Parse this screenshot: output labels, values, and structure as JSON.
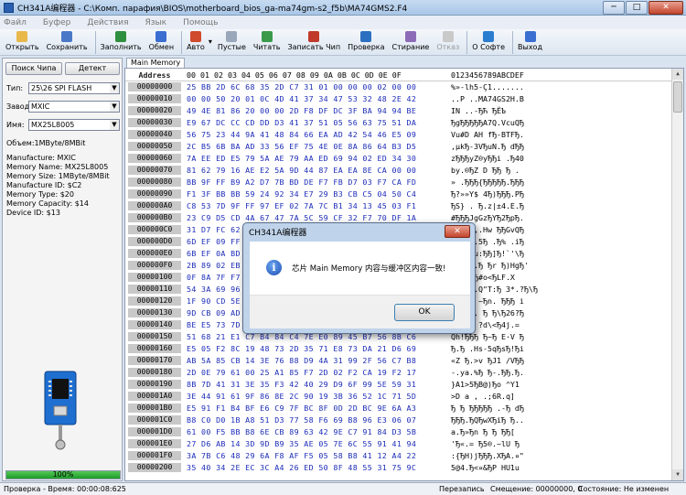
{
  "window": {
    "title": "CH341A编程器 - C:\\Комп. парафия\\BIOS\\motherboard_bios_ga-ma74gm-s2_f5b\\MA74GMS2.F4",
    "min": "─",
    "max": "□",
    "close": "✕"
  },
  "menu": [
    "Файл",
    "Буфер",
    "Действия",
    "Язык",
    "Помощь"
  ],
  "toolbar": [
    {
      "label": "Открыть",
      "color": "#e8b84a"
    },
    {
      "label": "Сохранить",
      "color": "#4a78c8"
    },
    {
      "label": "Заполнить",
      "color": "#2e8f3e"
    },
    {
      "label": "Обмен",
      "color": "#3a6ed0"
    },
    {
      "label": "Авто",
      "color": "#d04a2e"
    },
    {
      "label": "Пустые",
      "color": "#9aa7ba"
    },
    {
      "label": "Читать",
      "color": "#3a9a4a"
    },
    {
      "label": "Записать Чип",
      "color": "#c0392b"
    },
    {
      "label": "Проверка",
      "color": "#2b6fc0"
    },
    {
      "label": "Стирание",
      "color": "#8e6bb8"
    },
    {
      "label": "Отказ",
      "color": "#c9c9c9",
      "disabled": true
    },
    {
      "label": "О Софте",
      "color": "#2b7dd0"
    },
    {
      "label": "Выход",
      "color": "#3a6ed0"
    }
  ],
  "left": {
    "find_chip": "Поиск Чипа",
    "detect": "Детект",
    "type_label": "Тип:",
    "type_value": "25\\26 SPI FLASH",
    "vendor_label": "Завод:",
    "vendor_value": "MXIC",
    "name_label": "Имя:",
    "name_value": "MX25L8005",
    "size_line": "Объем:1MByte/8MBit",
    "details": [
      "Manufacture: MXIC",
      "Memory Name: MX25L8005",
      "Memory Size: 1MByte/8MBit",
      "Manufacture ID: $C2",
      "Memory Type: $20",
      "Memory Capacity: $14",
      "Device ID: $13"
    ],
    "progress": 100,
    "progress_text": "100%"
  },
  "tab": "Main Memory",
  "hex": {
    "address_label": "Address",
    "columns": "00 01 02 03 04 05 06 07 08 09 0A 0B 0C 0D 0E 0F",
    "ascii_header": "0123456789ABCDEF",
    "rows": [
      {
        "a": "00000000",
        "h": "25 BB 2D 6C 68 35 2D C7 31 01 00 00 00 02 00 00",
        "t": "%»-lh5-Ç1......."
      },
      {
        "a": "00000010",
        "h": "00 00 50 20 01 0C 4D 41 37 34 47 53 32 48 2E 42",
        "t": "..P ..MA74GS2H.B"
      },
      {
        "a": "00000020",
        "h": "49 4E 81 86 20 00 00 2D F8 DF DC 3F BA 94 94 BE",
        "t": "IN   ..-ЂЋ ЂЁЪ"
      },
      {
        "a": "00000030",
        "h": "E9 67 DC CC CD DD D3 41 37 51 05 56 63 75 51 DA",
        "t": "ЂgЂЂЂЂЂA7Q.VcuQЂ"
      },
      {
        "a": "00000040",
        "h": "56 75 23 44 9A 41 48 84 66 EA AD 42 54 46 E5 09",
        "t": "Vu#D AH fЂ-BTFЂ."
      },
      {
        "a": "00000050",
        "h": "2C B5 6B BA AD 33 56 EF 75 4E 0E 8A 86 64 B3 D5",
        "t": ",µkЂ-3VЂuN.Ђ dЂЂ"
      },
      {
        "a": "00000060",
        "h": "7A EE ED E5 79 5A AE 79 AA ED 69 94 02 ED 34 30",
        "t": "zЂЂЂyZ®yЂЂi .Ђ40"
      },
      {
        "a": "00000070",
        "h": "81 62 79 16 AE E2 5A 9D 44 87 EA EA 8E CA 00 00",
        "t": " by.®ЂZ D ЂЂ Ђ ."
      },
      {
        "a": "00000080",
        "h": "BB 9F FF B9 A2 D7 7B BD DE F7 FB D7 03 F7 CA FD",
        "t": "» .ЂЂЂ{ЂЂЂЂЂ.ЂЂЂ"
      },
      {
        "a": "00000090",
        "h": "F1 3F BB BB 59 24 92 34 E7 29 B3 CB C5 04 50 C4",
        "t": "Ђ?»»Y$ 4Ђ)ЂЂЂ.PЂ"
      },
      {
        "a": "000000A0",
        "h": "C8 53 7D 9F FF 97 EF 02 7A 7C B1 34 13 45 03 F1",
        "t": "ЂS} . Ђ.z|±4.E.Ђ"
      },
      {
        "a": "000000B0",
        "h": "23 C9 D5 CD 4A 67 47 7A 5C 59 CF 32 F7 70 DF 1A",
        "t": "#ЂЂЂJgGzЂYЂ2ЂpЂ."
      },
      {
        "a": "000000C0",
        "h": "31 D7 FC 62 7A 2C 1F 48 77 89 F8 EF 47 76 51 D1",
        "t": "1ЂЂbz,.Hw ЂЂGvQЂ"
      },
      {
        "a": "000000D0",
        "h": "6D EF 09 FF 22 07 35 BA 9F 88 2E B3 25 20 2E 69",
        "t": "mЂ.Ђ\".5Ђ .Ђ% .iЂ"
      },
      {
        "a": "000000E0",
        "h": "6B EF 0A BD 8A 75 3A 96 7C 5D 97 21 60 27 5C 54",
        "t": "kЂ.Ђ u:ЂЂ]Ђ!`'\\Ђ"
      },
      {
        "a": "000000F0",
        "h": "2B 89 02 EB 1D 02 DD 80 E2 72 20 FF 29 48 67 8F",
        "t": "+ .Ђ..Ђ Ђr Ђ)HgЂ'"
      },
      {
        "a": "00000100",
        "h": "0F 8A 7F F7 E6 C2 43 0F D8 23 6F 3C 62 4F 4C 46",
        "t": "  .ЂЂЂ.Ђ#o<ЂLF.X"
      },
      {
        "a": "00000110",
        "h": "54 3A 69 96 22 00 51 22 54 3A 2A 2E 20 3F 8E 4E",
        "t": "T:iЂ\".Q\"T:Ђ 3*.?Ђ\\Ђ"
      },
      {
        "a": "00000120",
        "h": "1F 90 CD 5E E5 8E 7E DF 6E 87 0D 81 42 AD 6D 69",
        "t": "..Ђ^Ђ ~Ђn. ЂЂЂ i"
      },
      {
        "a": "00000130",
        "h": "9D CB 09 AD 3E 4F 09 84 BF 83 5C 26 32 33 3D 8A",
        "t": "Ђ.Ђ>O. Ђ Ђ\\Ђ26?Ђ"
      },
      {
        "a": "00000140",
        "h": "BE E5 73 7D 7C 94 42 BE 3C 64 5C 34 6A 20 2E 3D",
        "t": "ЂЂs}| ?d\\<Ђ4j.="
      },
      {
        "a": "00000150",
        "h": "51 68 21 E1 C7 B4 84 C4 7E E0 89 45 B7 56 8B C6",
        "t": "Qh!ЂЂЂ Ђ~Ђ E·V Ђ"
      },
      {
        "a": "00000160",
        "h": "E5 05 F2 8C 19 48 73 2D 35 71 E8 73 DA 21 D6 69",
        "t": "Ђ.Ђ .Hs-5qЂsЂ!Ђi"
      },
      {
        "a": "00000170",
        "h": "AB 5A 85 CB 14 3E 76 88 D9 4A 31 99 2F 56 C7 B8",
        "t": "«Z Ђ.>v ЂJ1 /VЂЂ"
      },
      {
        "a": "00000180",
        "h": "2D 0E 79 61 00 25 A1 85 F7 2D 02 F2 CA 19 F2 17",
        "t": "-.ya.%Ђ Ђ-.ЂЂ.Ђ."
      },
      {
        "a": "00000190",
        "h": "8B 7D 41 31 3E 35 F3 42 40 29 D9 6F 99 5E 59 31",
        "t": " }A1>5ЂB@)Ђo ^Y1"
      },
      {
        "a": "000001A0",
        "h": "3E 44 91 61 9F 86 8E 2C 90 19 3B 36 52 1C 71 5D",
        "t": ">D a   , .;6R.q]"
      },
      {
        "a": "000001B0",
        "h": "E5 91 F1 B4 BF E6 C9 7F BC 8F 0D 2D BC 9E 6A A3",
        "t": "Ђ Ђ ЂЂЂЂЂ .-Ђ dЂ"
      },
      {
        "a": "000001C0",
        "h": "B8 C0 D0 1B A8 51 D3 77 58 F6 69 B8 96 E3 06 07",
        "t": "ЂЂЂ.ЂQЂwXЂiЂ Ђ.."
      },
      {
        "a": "000001D0",
        "h": "61 00 F5 BB B8 6E CB 89 63 42 9E C7 91 84 D3 5B",
        "t": "a.Ђ»Ђn Ђ Ђ ЂЂ["
      },
      {
        "a": "000001E0",
        "h": "27 D6 AB 14 3D 9D B9 35 AE 05 7E 6C 55 91 41 94",
        "t": "'Ђ«.= Ђ5®.~lU Ђ"
      },
      {
        "a": "000001F0",
        "h": "3A 7B C6 48 29 6A F8 AF F5 05 58 B8 41 12 A4 22",
        "t": ":{ЂH)jЂЂЂ.XЂA.¤\""
      },
      {
        "a": "00000200",
        "h": "35 40 34 2E EC 3C A4 26 ED 50 8F 48 55 31 75 9C",
        "t": "5@4.Ђ<¤&ЂP HU1u"
      }
    ]
  },
  "dialog": {
    "title": "CH341A编程器",
    "close": "✕",
    "icon": "i",
    "message": "芯片 Main Memory 内容与缓冲区内容一致!",
    "ok": "OK"
  },
  "status": {
    "left": "Проверка - Время: 00:00:08:625",
    "mode": "Перезапись",
    "offset": "Смещение: 00000000, 0",
    "state": "Состояние: Не изменен"
  }
}
